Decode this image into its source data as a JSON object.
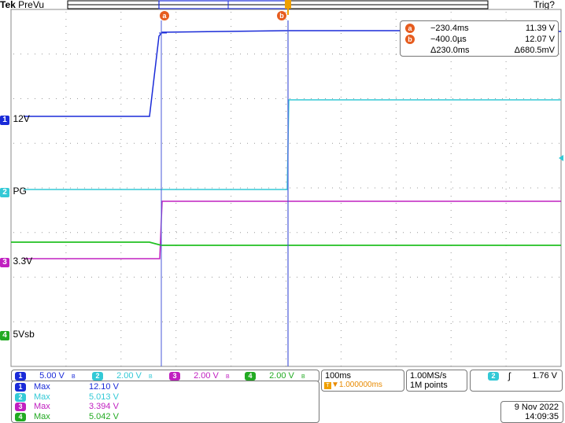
{
  "header": {
    "brand": "Tek",
    "mode": "PreVu",
    "trigger_status": "Trig?"
  },
  "cursors": {
    "a_label": "a",
    "b_label": "b"
  },
  "cursor_readout": {
    "rows": [
      {
        "id": "a",
        "time": "−230.4ms",
        "volt": "11.39 V"
      },
      {
        "id": "b",
        "time": "−400.0µs",
        "volt": "12.07 V"
      },
      {
        "id": "delta",
        "time": "Δ230.0ms",
        "volt": "Δ680.5mV"
      }
    ]
  },
  "channel_markers": [
    {
      "num": "1",
      "label": "12V",
      "color": "#1a2bd8"
    },
    {
      "num": "2",
      "label": "PG",
      "color": "#33c9d6"
    },
    {
      "num": "3",
      "label": "3.3V",
      "color": "#c020c0"
    },
    {
      "num": "4",
      "label": "5Vsb",
      "color": "#22aa22"
    }
  ],
  "vertical_scale": [
    {
      "num": "1",
      "value": "5.00 V",
      "color": "#1a2bd8"
    },
    {
      "num": "2",
      "value": "2.00 V",
      "color": "#33c9d6"
    },
    {
      "num": "3",
      "value": "2.00 V",
      "color": "#c020c0"
    },
    {
      "num": "4",
      "value": "2.00 V",
      "color": "#22aa22"
    }
  ],
  "bw_symbol": "B",
  "timebase": {
    "scale": "100ms",
    "delay": "▼1.000000ms",
    "sample_rate": "1.00MS/s",
    "record_length": "1M points"
  },
  "trigger": {
    "channel": "2",
    "slope_symbol": "ʃ",
    "level": "1.76 V"
  },
  "measurements": [
    {
      "num": "1",
      "name": "Max",
      "value": "12.10 V",
      "color": "#1a2bd8"
    },
    {
      "num": "2",
      "name": "Max",
      "value": "5.013 V",
      "color": "#33c9d6"
    },
    {
      "num": "3",
      "name": "Max",
      "value": "3.394 V",
      "color": "#c020c0"
    },
    {
      "num": "4",
      "name": "Max",
      "value": "5.042 V",
      "color": "#22aa22"
    }
  ],
  "datetime": {
    "date": "9 Nov 2022",
    "time": "14:09:35"
  }
}
